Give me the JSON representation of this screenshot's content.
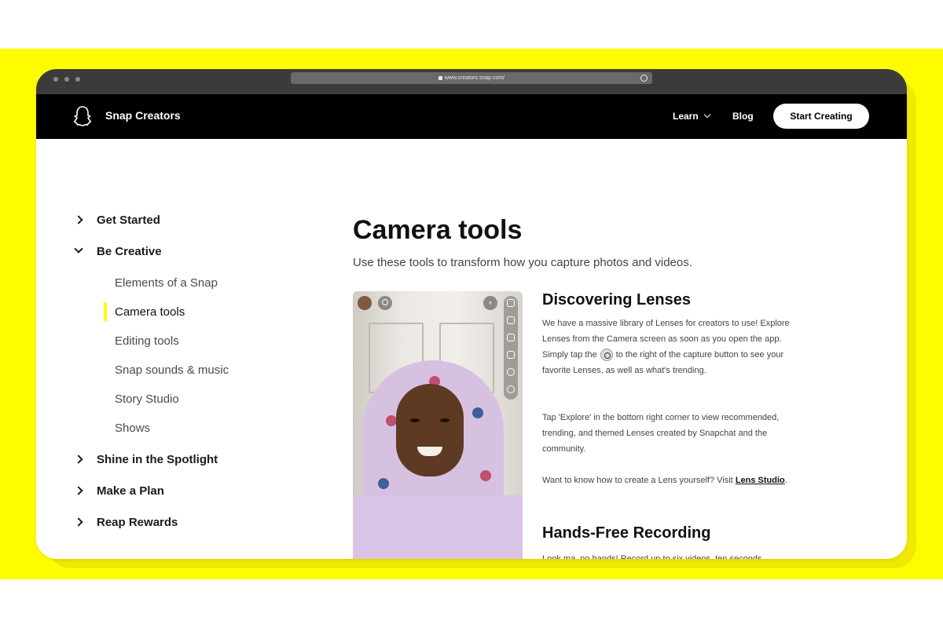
{
  "browser": {
    "url": "www.creators.snap.com/"
  },
  "navbar": {
    "brand": "Snap Creators",
    "learn_label": "Learn",
    "blog_label": "Blog",
    "cta_label": "Start Creating"
  },
  "sidebar": {
    "sections": [
      {
        "label": "Get Started",
        "expanded": false
      },
      {
        "label": "Be Creative",
        "expanded": true
      },
      {
        "label": "Shine in the Spotlight",
        "expanded": false
      },
      {
        "label": "Make a Plan",
        "expanded": false
      },
      {
        "label": "Reap Rewards",
        "expanded": false
      }
    ],
    "subitems": [
      "Elements of a Snap",
      "Camera tools",
      "Editing tools",
      "Snap sounds & music",
      "Story Studio",
      "Shows"
    ],
    "active_subitem": "Camera tools"
  },
  "main": {
    "title": "Camera tools",
    "subtitle": "Use these tools to transform how you capture photos and videos.",
    "section1": {
      "title": "Discovering Lenses",
      "p1_a": "We have a massive library of Lenses for creators to use! Explore Lenses from the Camera screen as soon as you open the app. Simply tap the",
      "p1_b": "to the right of the capture button to see your favorite Lenses, as well as what's trending.",
      "p2": "Tap 'Explore' in the bottom right corner to view recommended, trending, and themed Lenses created by Snapchat and the community.",
      "p3_a": "Want to know how to create a Lens yourself? Visit",
      "p3_link": "Lens Studio",
      "p3_b": "."
    },
    "section2": {
      "title": "Hands-Free Recording",
      "p1": "Look ma, no hands! Record up to six videos, ten seconds"
    }
  },
  "colors": {
    "snap_yellow": "#fffc00",
    "navbar_bg": "#000000"
  }
}
